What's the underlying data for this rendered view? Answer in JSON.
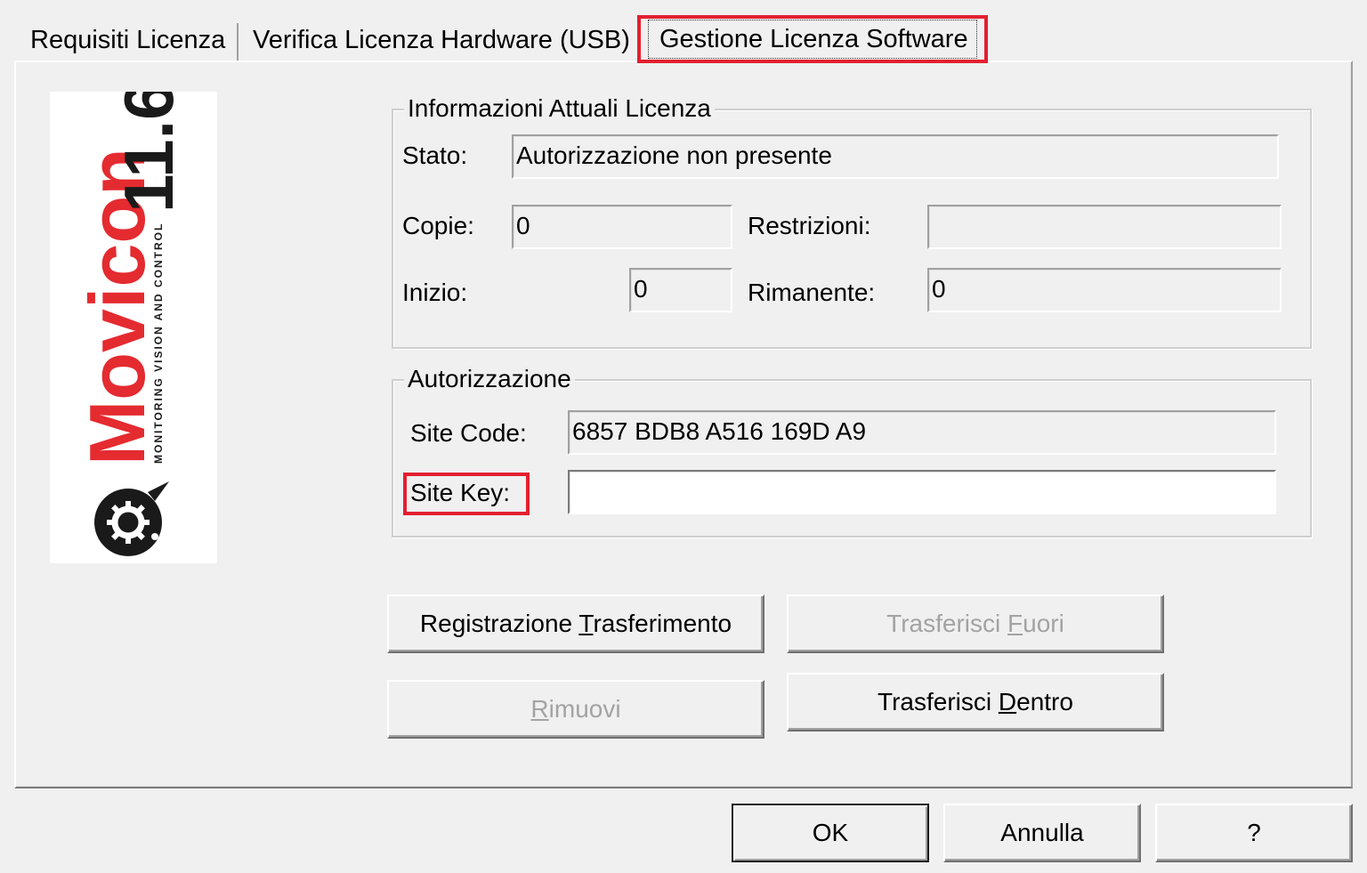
{
  "tabs": [
    {
      "label": "Requisiti Licenza"
    },
    {
      "label": "Verifica Licenza Hardware (USB)"
    },
    {
      "label": "Gestione Licenza Software"
    }
  ],
  "logo": {
    "brand": "Movicon",
    "version": "11.6",
    "tagline": "MONITORING VISION AND CONTROL"
  },
  "info_group": {
    "title": "Informazioni Attuali Licenza",
    "stato_label": "Stato:",
    "stato_value": "Autorizzazione non presente",
    "copie_label": "Copie:",
    "copie_value": "0",
    "restrizioni_label": "Restrizioni:",
    "restrizioni_value": "",
    "inizio_label": "Inizio:",
    "inizio_value": "0",
    "rimanente_label": "Rimanente:",
    "rimanente_value": "0"
  },
  "auth_group": {
    "title": "Autorizzazione",
    "site_code_label": "Site Code:",
    "site_code_value": "6857 BDB8 A516 169D A9",
    "site_key_label": "Site Key:",
    "site_key_value": ""
  },
  "actions": {
    "registrazione": {
      "before": "Registrazione ",
      "accel": "T",
      "after": "rasferimento"
    },
    "trasferisci_fuori": {
      "before": "Trasferisci ",
      "accel": "F",
      "after": "uori"
    },
    "rimuovi": {
      "before": "",
      "accel": "R",
      "after": "imuovi"
    },
    "trasferisci_dentro": {
      "before": "Trasferisci ",
      "accel": "D",
      "after": "entro"
    }
  },
  "footer": {
    "ok": "OK",
    "annulla": "Annulla",
    "help": "?"
  },
  "colors": {
    "highlight": "#e22030",
    "logo_red": "#e42b30",
    "logo_dark": "#1a1a1a"
  }
}
